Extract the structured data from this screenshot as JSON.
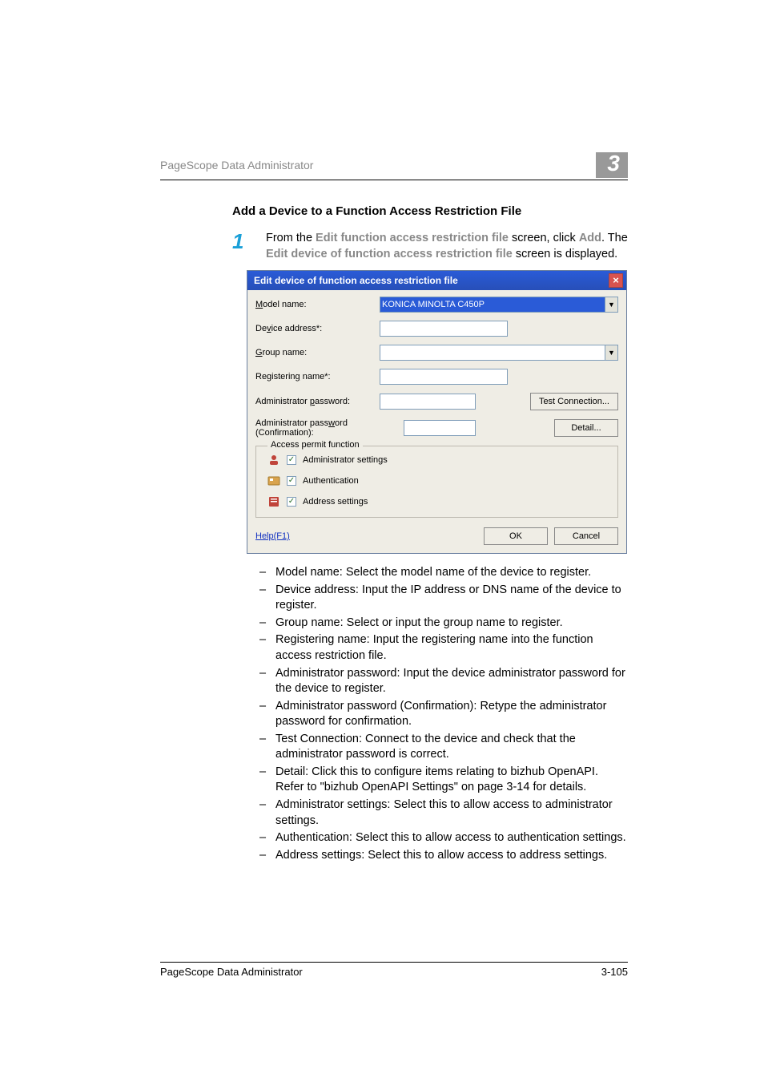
{
  "header": {
    "title": "PageScope Data Administrator",
    "chapter": "3"
  },
  "section_heading": "Add a Device to a Function Access Restriction File",
  "step1": {
    "number": "1",
    "line1_from": "From the ",
    "line1_gray": "Edit function access restriction file",
    "line1_mid": " screen, click ",
    "line1_gray2": "Add",
    "line1_end": ". The ",
    "line2_gray": "Edit device of function access restriction file",
    "line2_end": " screen is displayed."
  },
  "dialog": {
    "title": "Edit device of function access restriction file",
    "labels": {
      "model_name": "Model name:",
      "device_address": "Device address*:",
      "group_name": "Group name:",
      "registering_name": "Registering name*:",
      "admin_pw": "Administrator password:",
      "admin_pw_confirm": "Administrator password (Confirmation):"
    },
    "values": {
      "model_name": "KONICA MINOLTA C450P"
    },
    "buttons": {
      "test_connection": "Test Connection...",
      "detail": "Detail...",
      "ok": "OK",
      "cancel": "Cancel",
      "help": "Help(F1)"
    },
    "fieldset_legend": "Access permit function",
    "checks": {
      "admin_settings": "Administrator settings",
      "authentication": "Authentication",
      "address_settings": "Address settings"
    }
  },
  "bullets": {
    "b1": "Model name: Select the model name of the device to register.",
    "b2": "Device address: Input the IP address or DNS name of the device to register.",
    "b3": "Group name: Select or input the group name to register.",
    "b4": "Registering name: Input the registering name into the function access restriction file.",
    "b5": "Administrator password: Input the device administrator password for the device to register.",
    "b6": "Administrator password (Confirmation): Retype the administrator password for confirmation.",
    "b7": "Test Connection: Connect to the device and check that the administrator password is correct.",
    "b8": "Detail: Click this to configure items relating to bizhub OpenAPI. Refer to \"bizhub OpenAPI Settings\" on page 3-14 for details.",
    "b9": "Administrator settings: Select this to allow access to administrator settings.",
    "b10": "Authentication: Select this to allow access to authentication settings.",
    "b11": "Address settings: Select this to allow access to address settings."
  },
  "footer": {
    "left": "PageScope Data Administrator",
    "right": "3-105"
  }
}
